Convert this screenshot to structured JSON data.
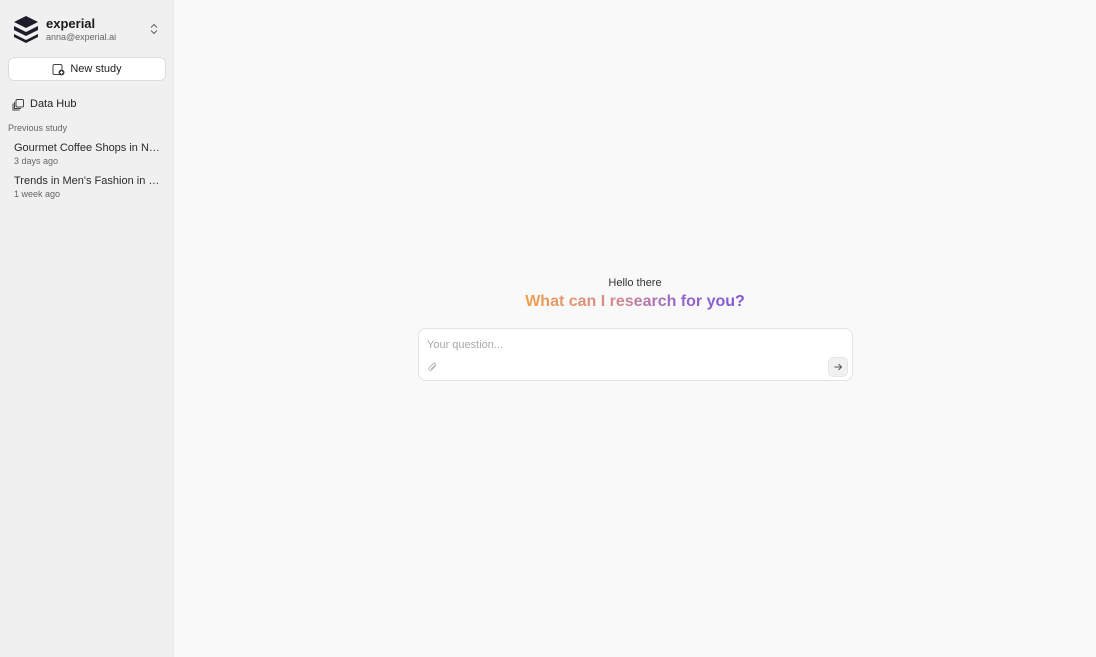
{
  "account": {
    "brand": "experial",
    "email": "anna@experial.ai"
  },
  "sidebar": {
    "new_study_label": "New study",
    "nav": [
      {
        "label": "Data Hub",
        "icon": "data-hub-icon"
      }
    ],
    "previous_title": "Previous study",
    "studies": [
      {
        "title": "Gourmet Coffee Shops in Ne...",
        "date": "3 days ago"
      },
      {
        "title": "Trends in Men's Fashion in It...",
        "date": "1 week ago"
      }
    ]
  },
  "main": {
    "greeting": "Hello there",
    "headline": "What can I research for you?",
    "input_placeholder": "Your question..."
  },
  "colors": {
    "sidebar_bg": "#f0f0f0",
    "main_bg": "#f9f9f9",
    "gradient_start": "#f0a04b",
    "gradient_end": "#7d55d4"
  }
}
